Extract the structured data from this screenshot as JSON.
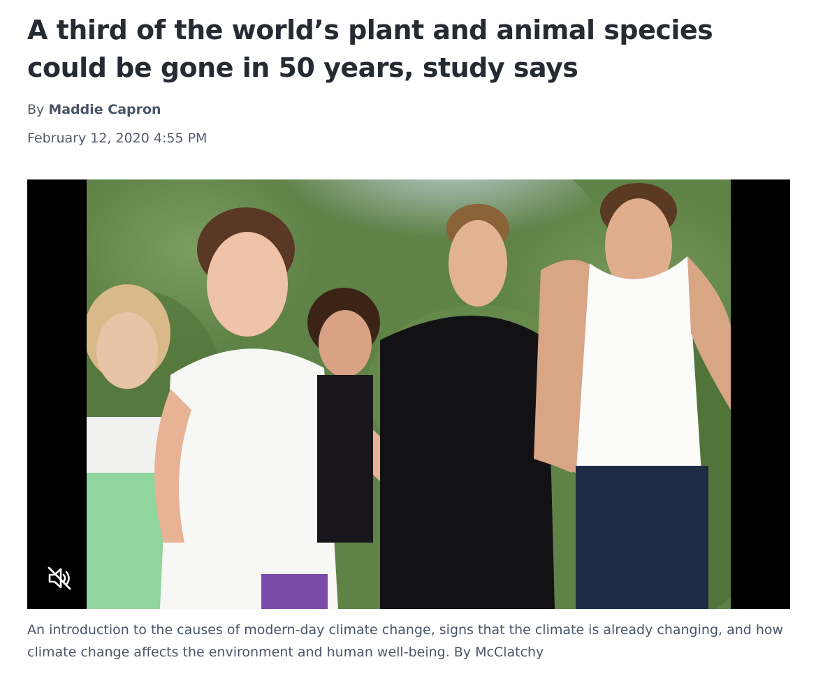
{
  "article": {
    "headline": "A third of the world’s plant and animal species could be gone in 50 years, study says",
    "byline_prefix": "By",
    "author": "Maddie Capron",
    "timestamp": "February 12, 2020 4:55 PM"
  },
  "video": {
    "mute_icon": "muted-speaker-icon",
    "muted": true
  },
  "caption": "An introduction to the causes of modern-day climate change, signs that the climate is already changing, and how climate change affects the environment and human well-being. By McClatchy",
  "colors": {
    "headline": "#262b33",
    "meta_text": "#555b66",
    "video_letterbox": "#000000"
  }
}
